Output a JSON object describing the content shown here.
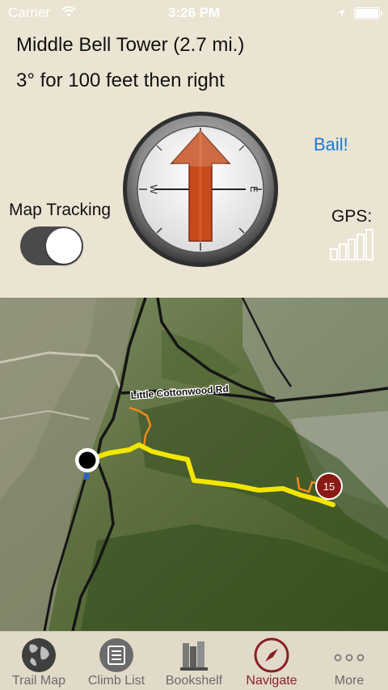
{
  "status_bar": {
    "carrier": "Carrier",
    "time": "3:26 PM"
  },
  "navigation": {
    "destination": "Middle Bell Tower (2.7 mi.)",
    "direction": "3° for 100 feet then right",
    "bail_label": "Bail!"
  },
  "compass": {
    "letters": {
      "west": "W",
      "east": "E"
    },
    "arrow_color": "#c64a1c"
  },
  "map_tracking": {
    "label": "Map Tracking",
    "enabled": true
  },
  "gps": {
    "label": "GPS:",
    "signal_bars_filled": 5,
    "signal_bars_total": 5
  },
  "map": {
    "road_label": "Little Cottonwood Rd",
    "marker_number": "15",
    "route_color": "#f2e600",
    "approach_color": "#f08a1c"
  },
  "tabbar": {
    "items": [
      {
        "label": "Trail Map",
        "icon": "globe-icon",
        "active": false
      },
      {
        "label": "Climb List",
        "icon": "list-icon",
        "active": false
      },
      {
        "label": "Bookshelf",
        "icon": "books-icon",
        "active": false
      },
      {
        "label": "Navigate",
        "icon": "compass-icon",
        "active": true
      },
      {
        "label": "More",
        "icon": "more-dots-icon",
        "active": false
      }
    ],
    "active_color": "#8a1f25"
  }
}
